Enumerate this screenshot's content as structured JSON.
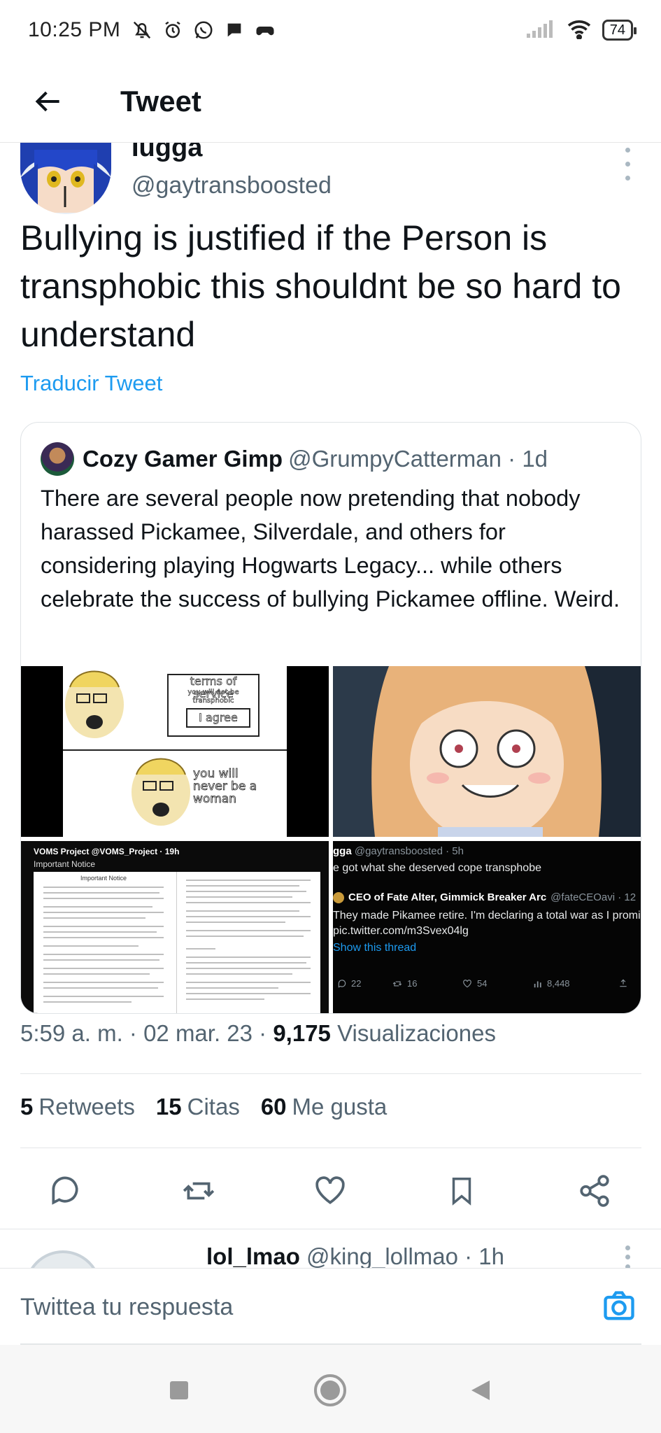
{
  "status_bar": {
    "time": "10:25 PM",
    "battery": "74",
    "left_icons": [
      "bell-off-icon",
      "alarm-icon",
      "whatsapp-icon",
      "chat-icon",
      "game-controller-icon"
    ],
    "right_icons": [
      "signal-icon",
      "wifi-icon",
      "battery-icon"
    ]
  },
  "header": {
    "title": "Tweet"
  },
  "tweet": {
    "author_name": "Iugga",
    "author_handle": "@gaytransboosted",
    "text": "Bullying is justified if the Person is transphobic this shouldnt be so hard to understand",
    "translate_label": "Traducir Tweet",
    "timestamp": "5:59 a. m. · 02 mar. 23 · ",
    "views_count": "9,175",
    "views_label": "Visualizaciones"
  },
  "quote": {
    "author_name": "Cozy Gamer Gimp",
    "author_handle": "@GrumpyCatterman · 1d",
    "text": "There are several people now pretending that nobody harassed Pickamee, Silverdale, and others for considering playing Hogwarts Legacy... while others celebrate the success of bullying Pickamee offline. Weird.",
    "images": {
      "meme_tos": {
        "line1": "terms of service",
        "line2": "you will not be transphobic",
        "line3": "I agree",
        "line4": "you will never be a woman"
      },
      "notice": {
        "header": "VOMS Project @VOMS_Project · 19h",
        "title": "Important Notice",
        "doc_title": "Important Notice"
      },
      "embedded_tweet": {
        "line1_name": "gga",
        "line1_handle": "@gaytransboosted · 5h",
        "line1_text": "e got what she deserved cope transphobe",
        "inner_name": "CEO of Fate Alter, Gimmick Breaker Arc",
        "inner_handle": "@fateCEOavi · 12",
        "inner_text": "They made Pikamee retire. I'm declaring a total war as I promis",
        "inner_link": "pic.twitter.com/m3Svex04lg",
        "show_thread": "Show this thread",
        "replies": "22",
        "retweets": "16",
        "likes": "54",
        "views": "8,448"
      }
    }
  },
  "stats": {
    "retweets_count": "5",
    "retweets_label": "Retweets",
    "quotes_count": "15",
    "quotes_label": "Citas",
    "likes_count": "60",
    "likes_label": "Me gusta"
  },
  "actions": [
    "reply-icon",
    "retweet-icon",
    "like-icon",
    "bookmark-icon",
    "share-icon"
  ],
  "reply_preview": {
    "name": "lol_lmao",
    "handle": "@king_lollmao · 1h"
  },
  "compose": {
    "placeholder": "Twittea tu respuesta"
  },
  "colors": {
    "accent": "#1d9bf0",
    "text": "#0f1419",
    "secondary": "#536471"
  }
}
